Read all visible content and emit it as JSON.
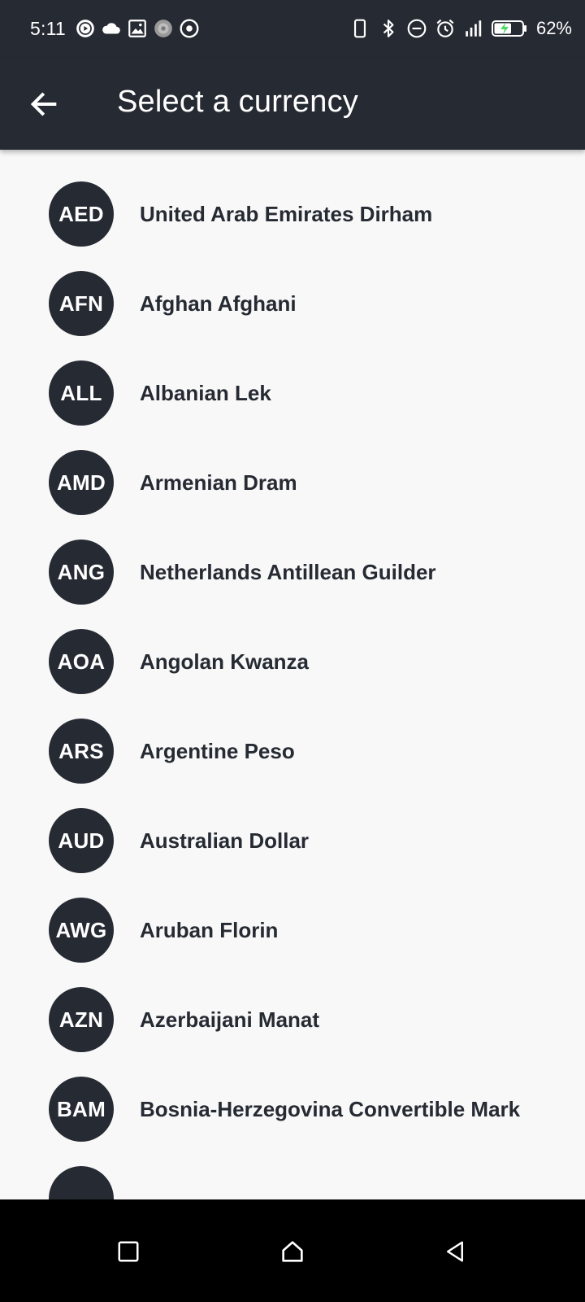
{
  "status_bar": {
    "time": "5:11",
    "battery_percent": "62%",
    "battery_level": 0.62,
    "left_icons": [
      "play-circle-icon",
      "cloud-icon",
      "image-icon",
      "app-icon",
      "target-icon"
    ],
    "right_icons": [
      "phone-icon",
      "bluetooth-icon",
      "do-not-disturb-icon",
      "alarm-icon",
      "signal-icon",
      "battery-charging-icon"
    ]
  },
  "app_bar": {
    "title": "Select a currency",
    "back_icon": "arrow-back-icon"
  },
  "colors": {
    "bar_bg": "#262a33",
    "list_bg": "#f8f8f8",
    "badge_bg": "#262a33",
    "text_dark": "#262a33",
    "battery_bolt": "#4cd964"
  },
  "currencies": [
    {
      "code": "AED",
      "name": "United Arab Emirates Dirham"
    },
    {
      "code": "AFN",
      "name": "Afghan Afghani"
    },
    {
      "code": "ALL",
      "name": "Albanian Lek"
    },
    {
      "code": "AMD",
      "name": "Armenian Dram"
    },
    {
      "code": "ANG",
      "name": "Netherlands Antillean Guilder"
    },
    {
      "code": "AOA",
      "name": "Angolan Kwanza"
    },
    {
      "code": "ARS",
      "name": "Argentine Peso"
    },
    {
      "code": "AUD",
      "name": "Australian Dollar"
    },
    {
      "code": "AWG",
      "name": "Aruban Florin"
    },
    {
      "code": "AZN",
      "name": "Azerbaijani Manat"
    },
    {
      "code": "BAM",
      "name": "Bosnia-Herzegovina Convertible Mark"
    },
    {
      "code": "",
      "name": ""
    }
  ],
  "nav_bar": {
    "buttons": [
      "recents-square-icon",
      "home-icon",
      "back-triangle-icon"
    ]
  }
}
